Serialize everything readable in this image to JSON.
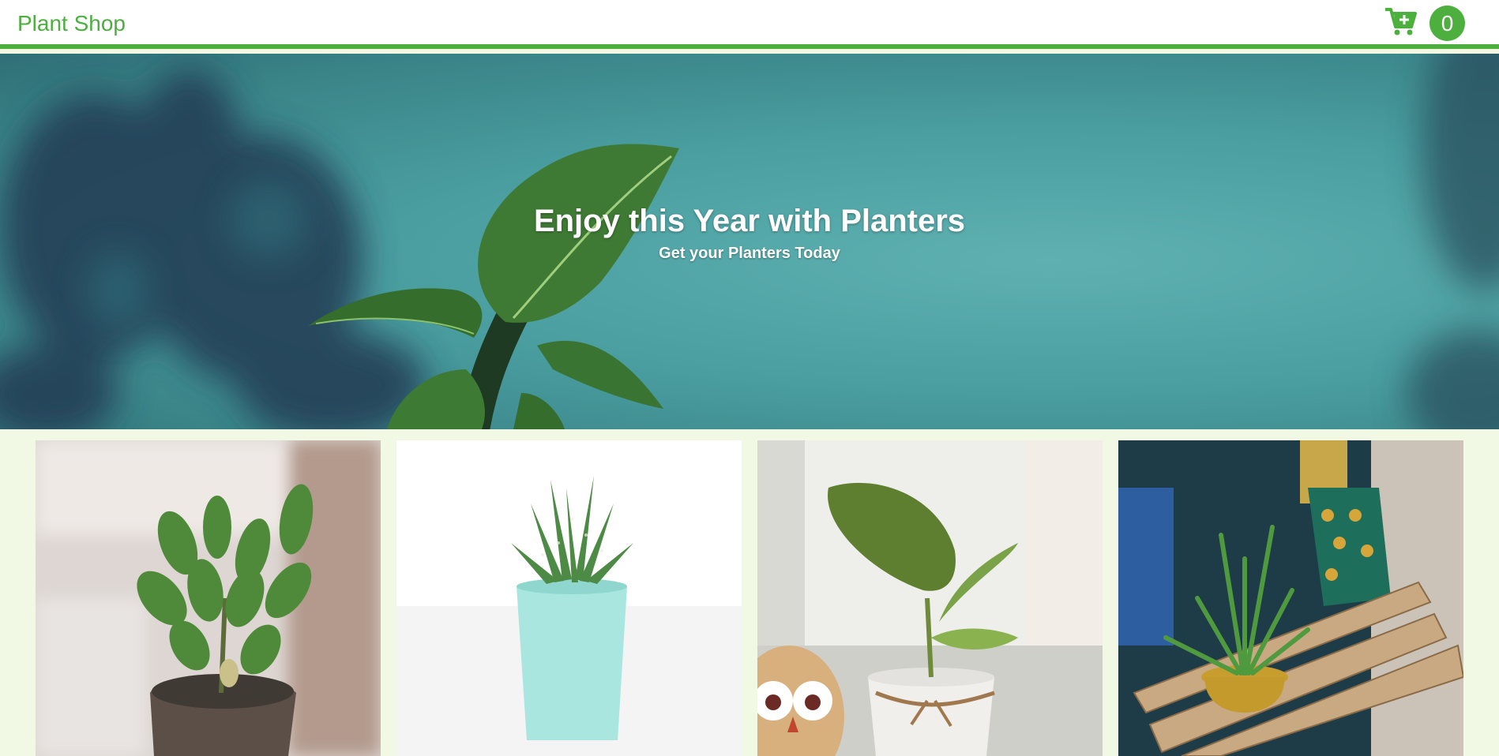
{
  "navbar": {
    "brand": "Plant Shop",
    "cart_icon": "cart-plus-icon",
    "cart_count": "0"
  },
  "hero": {
    "title": "Enjoy this Year with Planters",
    "subtitle": "Get your Planters Today"
  },
  "products": [
    {
      "image": "jade-plant-in-pot"
    },
    {
      "image": "haworthia-in-mint-pot"
    },
    {
      "image": "pothos-with-owl-figurine"
    },
    {
      "image": "aloe-in-brass-pot"
    }
  ],
  "colors": {
    "accent": "#4caf3e",
    "page_bg": "#f1f8e4",
    "hero_teal": "#4a9ea0"
  }
}
